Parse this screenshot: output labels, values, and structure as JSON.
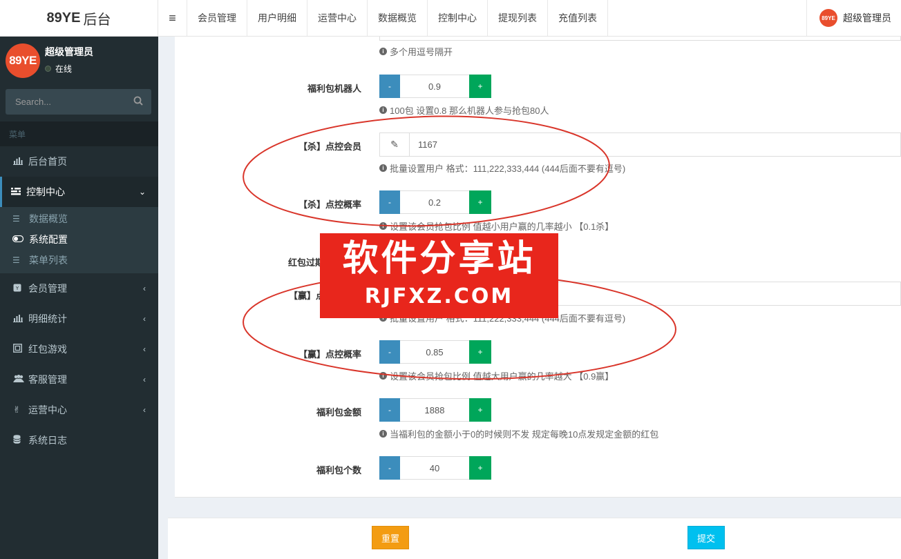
{
  "header": {
    "logo_brand": "89YE",
    "logo_suffix": "后台",
    "toggle_icon": "≡",
    "nav": [
      "会员管理",
      "用户明细",
      "运营中心",
      "数据概览",
      "控制中心",
      "提现列表",
      "充值列表"
    ],
    "user_avatar": "89YE",
    "user_name": "超级管理员"
  },
  "sidebar": {
    "avatar_text": "89YE",
    "user_name": "超级管理员",
    "status": "在线",
    "search_placeholder": "Search...",
    "menu_header": "菜单",
    "items": [
      {
        "label": "后台首页",
        "icon": "bar-chart"
      },
      {
        "label": "控制中心",
        "icon": "sliders",
        "expanded": true
      },
      {
        "label": "会员管理",
        "icon": "user-square"
      },
      {
        "label": "明细统计",
        "icon": "bar-chart"
      },
      {
        "label": "红包游戏",
        "icon": "gift"
      },
      {
        "label": "客服管理",
        "icon": "users"
      },
      {
        "label": "运营中心",
        "icon": "hand-peace"
      },
      {
        "label": "系统日志",
        "icon": "database"
      }
    ],
    "submenu": [
      {
        "label": "数据概览",
        "icon": "list"
      },
      {
        "label": "系统配置",
        "icon": "toggle",
        "current": true
      },
      {
        "label": "菜单列表",
        "icon": "list"
      }
    ]
  },
  "form": {
    "top_help": "多个用逗号隔开",
    "fields": {
      "bonus_robot": {
        "label": "福利包机器人",
        "value": "0.9",
        "help": "100包 设置0.8 那么机器人参与抢包80人"
      },
      "kill_members": {
        "label": "【杀】点控会员",
        "value": "1167",
        "help": "批量设置用户 格式：111,222,333,444 (444后面不要有逗号)"
      },
      "kill_rate": {
        "label": "【杀】点控概率",
        "value": "0.2",
        "help": "设置该会员抢包比例 值越小用户赢的几率越小 【0.1杀】"
      },
      "expire": {
        "label": "红包过期"
      },
      "win_members": {
        "label": "【赢】点控",
        "help": "批量设置用户 格式：111,222,333,444 (444后面不要有逗号)"
      },
      "win_rate": {
        "label": "【赢】点控概率",
        "value": "0.85",
        "help": "设置该会员抢包比例 值越大用户赢的几率越大 【0.9赢】"
      },
      "bonus_amount": {
        "label": "福利包金额",
        "value": "1888",
        "help": "当福利包的金额小于0的时候则不发 规定每晚10点发规定金额的红包"
      },
      "bonus_count": {
        "label": "福利包个数",
        "value": "40"
      }
    },
    "minus": "-",
    "plus": "+",
    "reset_label": "重置",
    "submit_label": "提交"
  },
  "watermark": {
    "cn": "软件分享站",
    "en": "RJFXZ.COM",
    "color": "#e8261c"
  },
  "colors": {
    "primary": "#3c8dbc",
    "success": "#00a65a",
    "warning": "#f39c12",
    "info": "#00c0ef",
    "sidebar": "#222d32"
  }
}
